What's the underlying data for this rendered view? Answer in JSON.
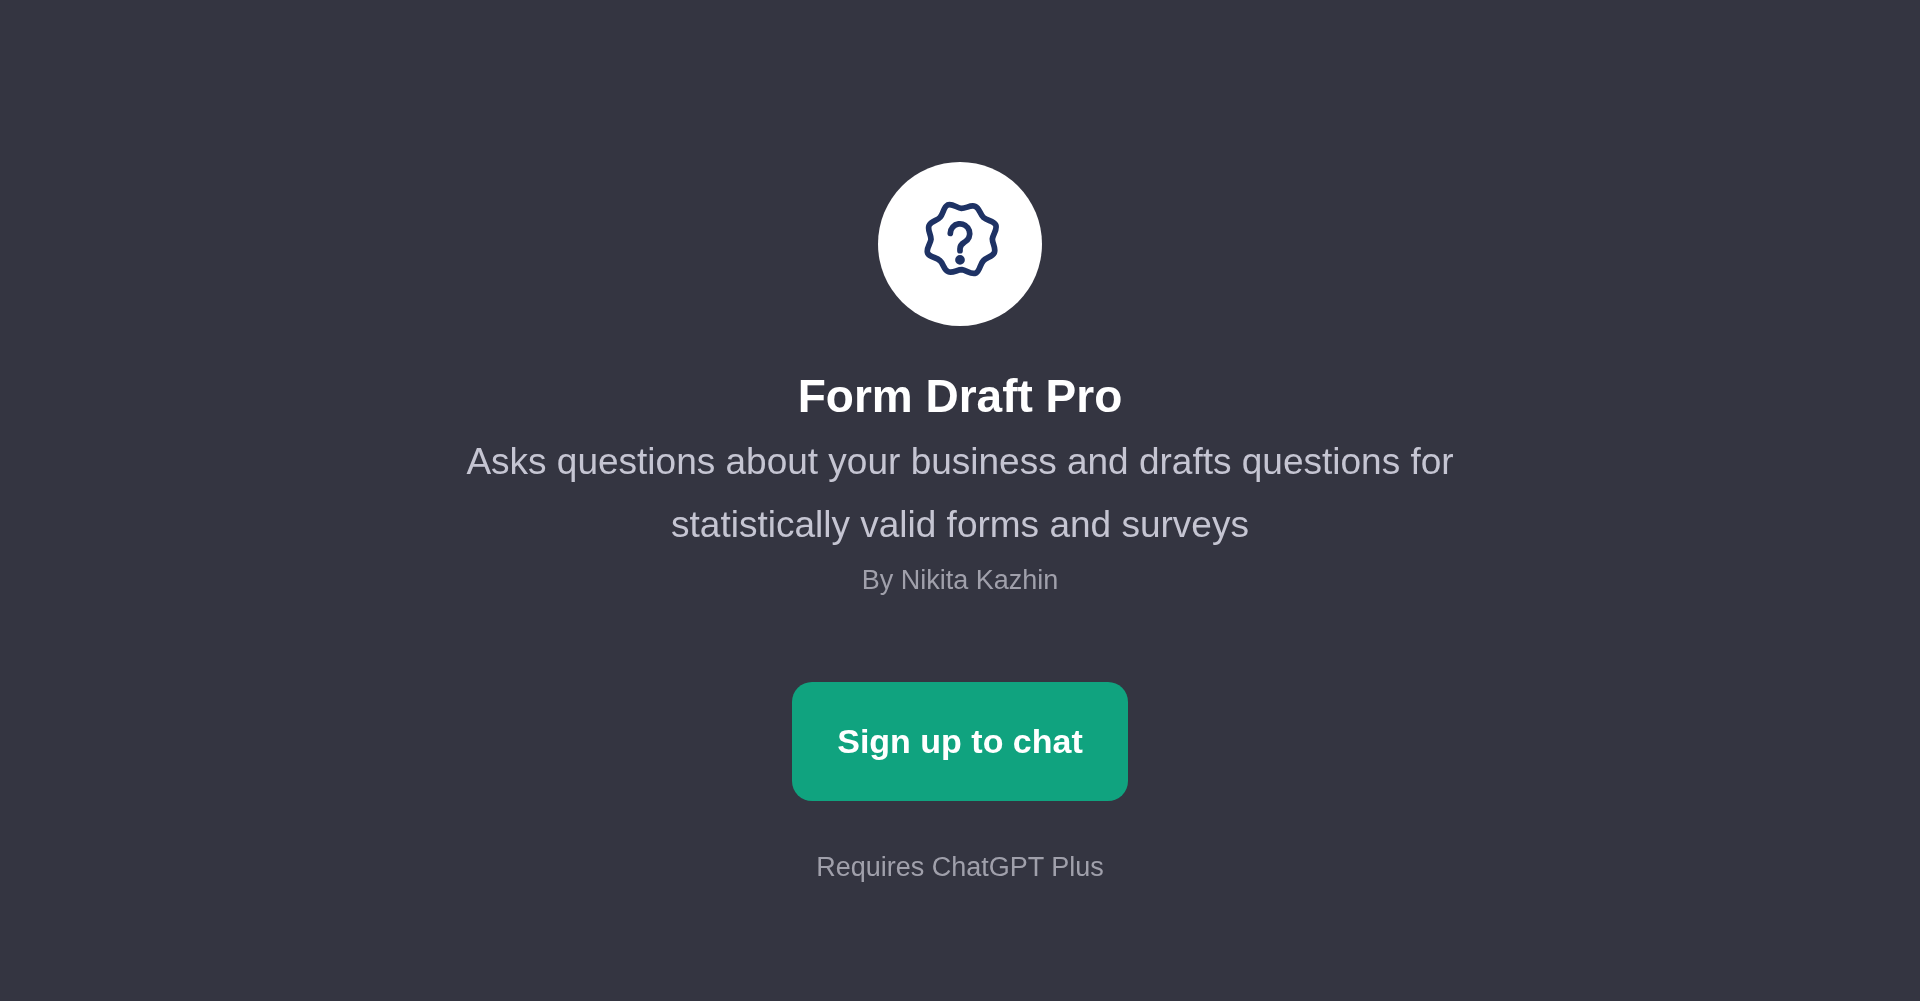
{
  "title": "Form Draft Pro",
  "description": "Asks questions about your business and drafts questions for statistically valid forms and surveys",
  "author": "By Nikita Kazhin",
  "button": "Sign up to chat",
  "note": "Requires ChatGPT Plus"
}
